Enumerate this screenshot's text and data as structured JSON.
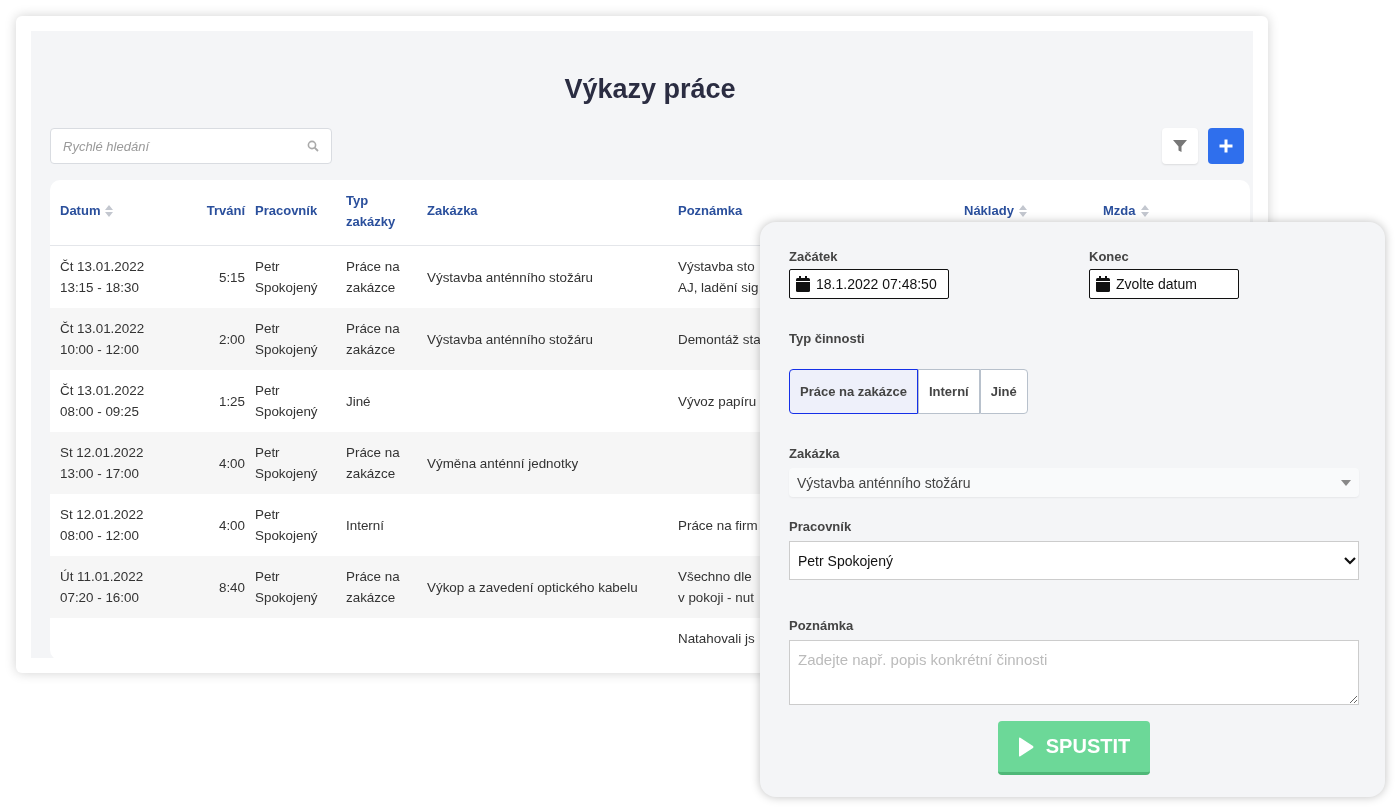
{
  "page": {
    "title": "Výkazy práce"
  },
  "search": {
    "placeholder": "Rychlé hledání"
  },
  "table": {
    "columns": [
      {
        "label": "Datum",
        "sortable": true
      },
      {
        "label": "Trvání",
        "sortable": false
      },
      {
        "label": "Pracovník",
        "sortable": false
      },
      {
        "label": "Typ\nzakázky",
        "sortable": false
      },
      {
        "label": "Zakázka",
        "sortable": false
      },
      {
        "label": "Poznámka",
        "sortable": false
      },
      {
        "label": "Náklady",
        "sortable": true
      },
      {
        "label": "Mzda",
        "sortable": true
      }
    ],
    "rows": [
      {
        "cells": [
          "Čt 13.01.2022\n13:15 - 18:30",
          "5:15",
          "Petr\nSpokojený",
          "Práce na\nzakázce",
          "Výstavba anténního stožáru",
          "Výstavba sto\nAJ, ladění sig"
        ]
      },
      {
        "cells": [
          "Čt 13.01.2022\n10:00 - 12:00",
          "2:00",
          "Petr\nSpokojený",
          "Práce na\nzakázce",
          "Výstavba anténního stožáru",
          "Demontáž sta"
        ]
      },
      {
        "cells": [
          "Čt 13.01.2022\n08:00 - 09:25",
          "1:25",
          "Petr\nSpokojený",
          "Jiné",
          "",
          "Vývoz papíru"
        ]
      },
      {
        "cells": [
          "St 12.01.2022\n13:00 - 17:00",
          "4:00",
          "Petr\nSpokojený",
          "Práce na\nzakázce",
          "Výměna anténní jednotky",
          ""
        ]
      },
      {
        "cells": [
          "St 12.01.2022\n08:00 - 12:00",
          "4:00",
          "Petr\nSpokojený",
          "Interní",
          "",
          "Práce na firm"
        ]
      },
      {
        "cells": [
          "Út 11.01.2022\n07:20 - 16:00",
          "8:40",
          "Petr\nSpokojený",
          "Práce na\nzakázce",
          "Výkop a zavedení optického kabelu",
          "Všechno dle\nv pokoji - nut"
        ]
      },
      {
        "cells": [
          "",
          "",
          "",
          "",
          "",
          "Natahovali js"
        ]
      }
    ]
  },
  "form": {
    "start": {
      "label": "Začátek",
      "value": "18.1.2022 07:48:50"
    },
    "end": {
      "label": "Konec",
      "value": "Zvolte datum"
    },
    "activity_type": {
      "label": "Typ činnosti",
      "options": [
        {
          "label": "Práce na zakázce",
          "selected": true
        },
        {
          "label": "Interní",
          "selected": false
        },
        {
          "label": "Jiné",
          "selected": false
        }
      ]
    },
    "order": {
      "label": "Zakázka",
      "value": "Výstavba anténního stožáru"
    },
    "worker": {
      "label": "Pracovník",
      "value": "Petr Spokojený"
    },
    "note": {
      "label": "Poznámka",
      "placeholder": "Zadejte např. popis konkrétní činnosti"
    },
    "submit": "SPUSTIT"
  }
}
